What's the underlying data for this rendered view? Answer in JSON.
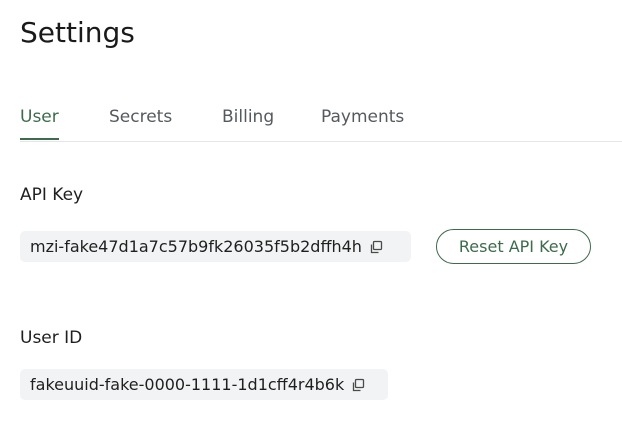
{
  "page": {
    "title": "Settings"
  },
  "tabs": [
    {
      "label": "User",
      "active": true
    },
    {
      "label": "Secrets",
      "active": false
    },
    {
      "label": "Billing",
      "active": false
    },
    {
      "label": "Payments",
      "active": false
    }
  ],
  "api_key": {
    "label": "API Key",
    "value": "mzi-fake47d1a7c57b9fk26035f5b2dffh4h",
    "copy_icon": "copy-icon",
    "reset_label": "Reset API Key"
  },
  "user_id": {
    "label": "User ID",
    "value": "fakeuuid-fake-0000-1111-1d1cff4r4b6k",
    "copy_icon": "copy-icon"
  },
  "colors": {
    "accent": "#3e6b4e",
    "box_background": "#f2f3f4",
    "divider": "#e6e6e6",
    "inactive_tab": "#555a5f"
  }
}
